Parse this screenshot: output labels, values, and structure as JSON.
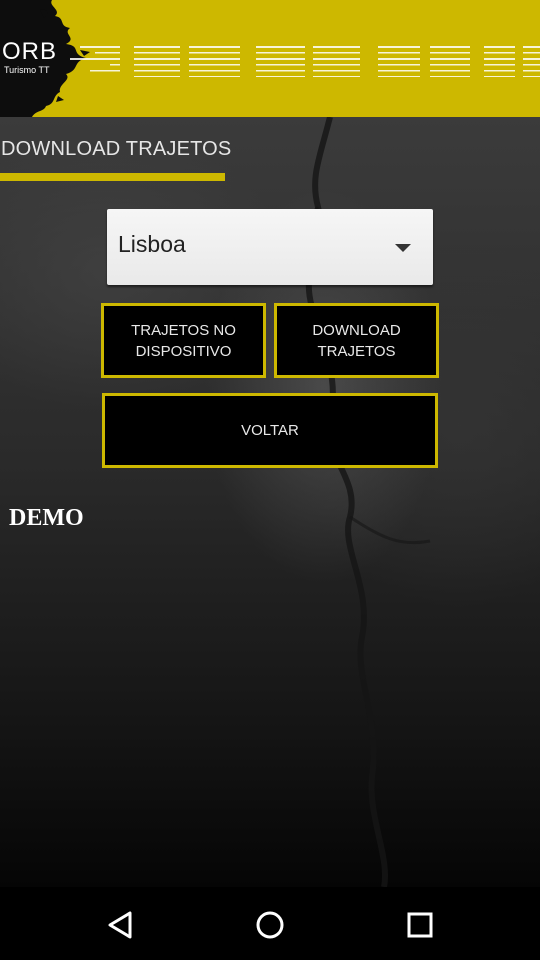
{
  "header": {
    "logo_main": "ORB",
    "logo_sub": "Turismo TT",
    "brand_color": "#cdb800"
  },
  "page": {
    "title": "DOWNLOAD TRAJETOS",
    "demo_label": "DEMO"
  },
  "city_select": {
    "selected": "Lisboa"
  },
  "buttons": {
    "trajetos_no_dispositivo": "TRAJETOS NO\nDISPOSITIVO",
    "download_trajetos": "DOWNLOAD\nTRAJETOS",
    "voltar": "VOLTAR"
  },
  "navbar": {
    "icons": [
      "back-icon",
      "home-icon",
      "recents-icon"
    ]
  }
}
